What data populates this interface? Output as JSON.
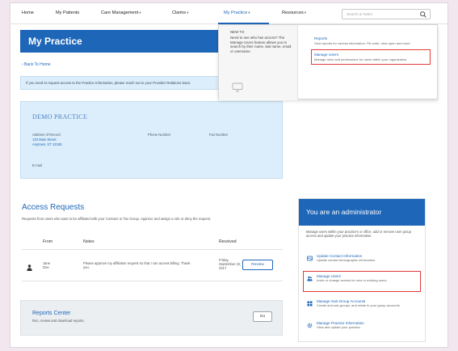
{
  "nav": {
    "items": [
      {
        "label": "Home",
        "caret": ""
      },
      {
        "label": "My Patients",
        "caret": ""
      },
      {
        "label": "Care Management",
        "caret": "▾"
      },
      {
        "label": "Claims",
        "caret": "▾"
      },
      {
        "label": "My Practice",
        "caret": "▾"
      },
      {
        "label": "Resources",
        "caret": "▾"
      }
    ],
    "search_placeholder": "Search & Tasks"
  },
  "page": {
    "title": "My Practice",
    "back_link": "‹ Back To Home",
    "notice": "If you need to request access to the Practice Information, please reach out to your Provider Relations team."
  },
  "practice": {
    "name": "DEMO PRACTICE",
    "address_label": "Address of Record",
    "address_line1": "123 Main Street",
    "address_line2": "Anytown, ST 12345",
    "phone_label": "Phone Number",
    "fax_label": "Fax Number",
    "email_label": "E-mail"
  },
  "access_requests": {
    "title": "Access Requests",
    "description": "Requests from users who want to be affiliated with your Contract or Tax Group. Approve and assign a role or deny the request.",
    "columns": {
      "from": "From",
      "notes": "Notes",
      "received": "Received"
    },
    "rows": [
      {
        "from_line1": "Jane",
        "from_line2": "Doe",
        "notes_line1": "Please approve my affiliation request so that I can access billing. Thank",
        "notes_line2": "you.",
        "received_line1": "Friday,",
        "received_line2": "September 22,",
        "received_line3": "2017",
        "action": "Review"
      }
    ]
  },
  "reports": {
    "title": "Reports Center",
    "description": "Run, review and download reports.",
    "button": "Go"
  },
  "admin": {
    "title": "You are an administrator",
    "description": "Manage users within your practice's or office, add or remove user group access and update your practice information.",
    "items": [
      {
        "title": "Update Contact Information",
        "desc": "Update contact demographic information."
      },
      {
        "title": "Manage Users",
        "desc": "Invite or change access for new or existing users."
      },
      {
        "title": "Manage Sub-Group Accounts",
        "desc": "Create and sub-groups, and relate to your group accounts."
      },
      {
        "title": "Manage Practice Information",
        "desc": "View and update your practice."
      }
    ]
  },
  "dropdown": {
    "intro_title": "NEW TO",
    "intro": "Need to see who has access? The Manage Users feature allows you to search by their name, last name, email or username.",
    "links": [
      {
        "label": "Reports",
        "desc": "View reports for various information. Fill order, view open and more."
      },
      {
        "label": "Manage Users",
        "desc": "Manage roles and permissions for users within your organization."
      }
    ]
  },
  "colors": {
    "accent": "#1e66b8",
    "highlight": "#e23b3b",
    "panel": "#dceefb"
  }
}
